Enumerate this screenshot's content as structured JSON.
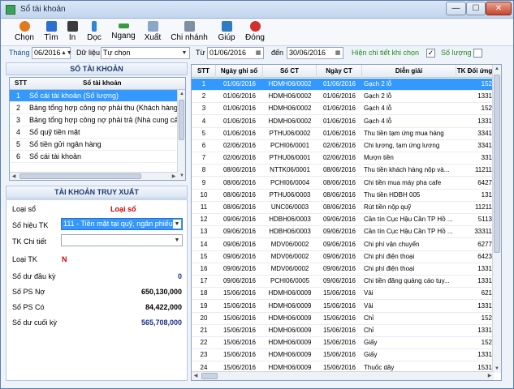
{
  "window": {
    "title": "Sổ tài khoản",
    "btn_min": "—",
    "btn_max": "☐",
    "btn_close": "✕"
  },
  "toolbar": {
    "items": [
      {
        "label": "Chọn",
        "icon": "gear-icon",
        "color": "#e07a1a"
      },
      {
        "label": "Tìm",
        "icon": "search-icon",
        "color": "#2c6fd1"
      },
      {
        "label": "In",
        "icon": "printer-icon",
        "color": "#3b3b3b"
      },
      {
        "label": "Dọc",
        "icon": "vertical-arrows-icon",
        "color": "#2f86d6"
      },
      {
        "label": "Ngang",
        "icon": "horizontal-arrows-icon",
        "color": "#3a9a3a"
      },
      {
        "label": "Xuất",
        "icon": "export-icon",
        "color": "#8aa7c7"
      },
      {
        "label": "Chi nhánh",
        "icon": "branch-icon",
        "color": "#7f8fa3"
      },
      {
        "label": "Giúp",
        "icon": "help-book-icon",
        "color": "#2f7cc4"
      },
      {
        "label": "Đóng",
        "icon": "power-icon",
        "color": "#d32f2f"
      }
    ]
  },
  "filter": {
    "month_label": "Tháng",
    "month_value": "06/2016",
    "data_label": "Dữ liệu",
    "data_value": "Tự chọn",
    "from_label": "Từ",
    "from_value": "01/06/2016",
    "to_label": "đến",
    "to_value": "30/06/2016",
    "show_detail_label": "Hiện chi tiết khi chọn",
    "show_detail_checked": "✓",
    "quantity_label": "Số lượng",
    "quantity_checked": ""
  },
  "accounts": {
    "title": "SỔ TÀI KHOẢN",
    "col_stt": "STT",
    "col_name": "Sổ tài khoản",
    "rows": [
      {
        "stt": "1",
        "name": "Sổ cái tài khoản (Số lượng)"
      },
      {
        "stt": "2",
        "name": "Bảng tổng hợp công nợ phải thu (Khách hàng)"
      },
      {
        "stt": "3",
        "name": "Bảng tổng hợp công nợ phải trả (Nhà cung cấp)"
      },
      {
        "stt": "4",
        "name": "Sổ quỹ tiền mặt"
      },
      {
        "stt": "5",
        "name": "Sổ tiền gửi ngân hàng"
      },
      {
        "stt": "6",
        "name": "Sổ cái tài khoản"
      }
    ]
  },
  "lookup": {
    "title": "TÀI KHOẢN TRUY XUẤT",
    "loai_so_label": "Loại sổ",
    "loai_so_value": "Loại sổ",
    "so_hieu_label": "Số hiệu TK",
    "so_hieu_value": "111 - Tiền mặt tại quỹ, ngân phiếu",
    "tk_chi_tiet_label": "TK Chi tiết",
    "tk_chi_tiet_value": "",
    "loai_tk_label": "Loại TK",
    "loai_tk_value": "N",
    "du_dau_label": "Số dư đầu kỳ",
    "du_dau_value": "0",
    "ps_no_label": "Số PS Nợ",
    "ps_no_value": "650,130,000",
    "ps_co_label": "Số PS Có",
    "ps_co_value": "84,422,000",
    "du_cuoi_label": "Số dư cuối kỳ",
    "du_cuoi_value": "565,708,000"
  },
  "ledger": {
    "columns": [
      "STT",
      "Ngày ghi sổ",
      "Số CT",
      "Ngày CT",
      "Diễn giải",
      "TK Đối ứng"
    ],
    "rows": [
      [
        "1",
        "01/06/2016",
        "HDMH06/0002",
        "01/06/2016",
        "Gạch 2 lỗ",
        "152"
      ],
      [
        "2",
        "01/06/2016",
        "HDMH06/0002",
        "01/06/2016",
        "Gạch 2 lỗ",
        "1331"
      ],
      [
        "3",
        "01/06/2016",
        "HDMH06/0002",
        "01/06/2016",
        "Gạch 4 lỗ",
        "152"
      ],
      [
        "4",
        "01/06/2016",
        "HDMH06/0002",
        "01/06/2016",
        "Gạch 4 lỗ",
        "1331"
      ],
      [
        "5",
        "01/06/2016",
        "PTHU06/0002",
        "01/06/2016",
        "Thu tiền tạm ứng mua hàng",
        "3341"
      ],
      [
        "6",
        "02/06/2016",
        "PCHI06/0001",
        "02/06/2016",
        "Chi lương, tạm ứng lương",
        "3341"
      ],
      [
        "7",
        "02/06/2016",
        "PTHU06/0001",
        "02/06/2016",
        "Mượn tiền",
        "331"
      ],
      [
        "8",
        "08/06/2016",
        "NTTK06/0001",
        "08/06/2016",
        "Thu tiền khách hàng nộp và...",
        "11211"
      ],
      [
        "9",
        "08/06/2016",
        "PCHI06/0004",
        "08/06/2016",
        "Chi tiền mua máy pha cafe",
        "6427"
      ],
      [
        "10",
        "08/06/2016",
        "PTHU06/0003",
        "08/06/2016",
        "Thu tiền HDBH 005",
        "131"
      ],
      [
        "11",
        "08/06/2016",
        "UNC06/0003",
        "08/06/2016",
        "Rút tiền nộp quỹ",
        "11211"
      ],
      [
        "12",
        "09/06/2016",
        "HDBH06/0003",
        "09/06/2016",
        "Cần tín Cục Hậu Cần TP Hồ ...",
        "5113"
      ],
      [
        "13",
        "09/06/2016",
        "HDBH06/0003",
        "09/06/2016",
        "Cần tín Cục Hậu Cần TP Hồ ...",
        "33311"
      ],
      [
        "14",
        "09/06/2016",
        "MDV06/0002",
        "09/06/2016",
        "Chi phí vận chuyển",
        "6277"
      ],
      [
        "15",
        "09/06/2016",
        "MDV06/0002",
        "09/06/2016",
        "Chi phí điện thoại",
        "6423"
      ],
      [
        "16",
        "09/06/2016",
        "MDV06/0002",
        "09/06/2016",
        "Chi phí điện thoại",
        "1331"
      ],
      [
        "17",
        "09/06/2016",
        "PCHI06/0005",
        "09/06/2016",
        "Chi tiền đăng quảng cáo tuy...",
        "1331"
      ],
      [
        "18",
        "15/06/2016",
        "HDMH06/0009",
        "15/06/2016",
        "Vải",
        "621"
      ],
      [
        "19",
        "15/06/2016",
        "HDMH06/0009",
        "15/06/2016",
        "Vải",
        "1331"
      ],
      [
        "20",
        "15/06/2016",
        "HDMH06/0009",
        "15/06/2016",
        "Chỉ",
        "152"
      ],
      [
        "21",
        "15/06/2016",
        "HDMH06/0009",
        "15/06/2016",
        "Chỉ",
        "1331"
      ],
      [
        "22",
        "15/06/2016",
        "HDMH06/0009",
        "15/06/2016",
        "Giấy",
        "152"
      ],
      [
        "23",
        "15/06/2016",
        "HDMH06/0009",
        "15/06/2016",
        "Giấy",
        "1331"
      ],
      [
        "24",
        "15/06/2016",
        "HDMH06/0009",
        "15/06/2016",
        "Thuốc dây",
        "1531"
      ]
    ]
  },
  "colors": {
    "selection": "#3399ff",
    "accent_red": "#cc0000",
    "accent_blue": "#1a2f8a",
    "accent_green": "#1f8a1f"
  }
}
